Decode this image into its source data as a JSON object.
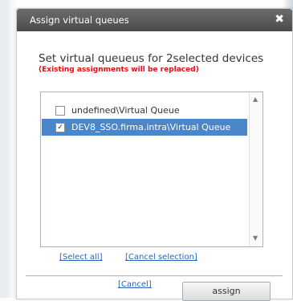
{
  "dialog": {
    "title": "Assign virtual queues",
    "heading": "Set virtual queueus for 2selected devices",
    "warning": "(Existing assignments will be replaced)"
  },
  "queues": [
    {
      "label": "undefined\\Virtual Queue",
      "checked": false,
      "selected": false
    },
    {
      "label": "DEV8_SSO.firma.intra\\Virtual Queue",
      "checked": true,
      "selected": true
    }
  ],
  "links": {
    "select_all": "[Select all]",
    "cancel_selection": "[Cancel selection]",
    "cancel": "[Cancel]"
  },
  "buttons": {
    "assign": "assign"
  },
  "icons": {
    "close": "close-icon",
    "checkbox_checked": "✓",
    "scroll_up": "▲",
    "scroll_down": "▼"
  },
  "colors": {
    "selection": "#4a86c8",
    "warning": "#e01010",
    "link": "#2a63b8"
  }
}
